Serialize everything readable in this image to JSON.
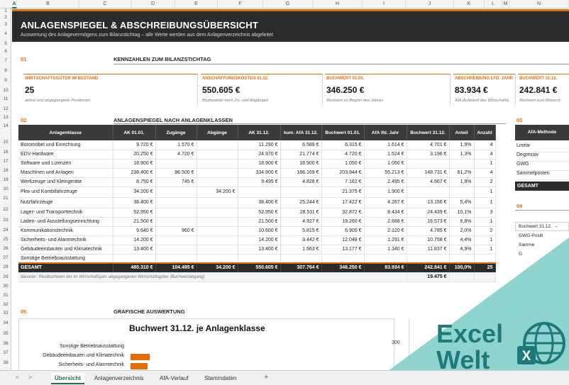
{
  "columns": [
    "A",
    "B",
    "C",
    "D",
    "E",
    "F",
    "G",
    "H",
    "I",
    "J",
    "K",
    "L",
    "M",
    "N"
  ],
  "rows": [
    "1",
    "2",
    "3",
    "4",
    "5",
    "6",
    "7",
    "8",
    "9",
    "10",
    "11",
    "12",
    "13",
    "14",
    "15",
    "16",
    "17",
    "18",
    "19",
    "20",
    "21",
    "22",
    "23",
    "24",
    "25",
    "26",
    "27",
    "28",
    "29",
    "30",
    "31",
    "32",
    "33",
    "34",
    "35",
    "36",
    "37",
    "38"
  ],
  "header": {
    "title": "ANLAGENSPIEGEL & ABSCHREIBUNGSÜBERSICHT",
    "subtitle": "Auswertung des Anlagevermögens zum Bilanzstichtag – alle Werte werden aus dem Anlagenverzeichnis abgeleitet"
  },
  "sections": {
    "s01": {
      "num": "01",
      "title": "KENNZAHLEN ZUM BILANZSTICHTAG"
    },
    "s02": {
      "num": "02",
      "title": "ANLAGENSPIEGEL NACH ANLAGENKLASSEN"
    },
    "s03": {
      "num": "03"
    },
    "s04": {
      "num": "04"
    },
    "s05": {
      "num": "05",
      "title": "GRAFISCHE AUSWERTUNG"
    }
  },
  "kpis": [
    {
      "label": "WIRTSCHAFTSGÜTER IM BESTAND",
      "value": "25",
      "sub": "aktive und abgegangene Positionen"
    },
    {
      "label": "ANSCHAFFUNGSKOSTEN 31.12.",
      "value": "550.605 €",
      "sub": "Bruttowerte nach Zu- und Abgängen"
    },
    {
      "label": "BUCHWERT 01.01.",
      "value": "346.250 €",
      "sub": "Restwert zu Beginn des Jahres"
    },
    {
      "label": "ABSCHREIBUNG LFD. JAHR",
      "value": "83.934 €",
      "sub": "AfA-Aufwand des Wirtschaftsj"
    },
    {
      "label": "BUCHWERT 31.12.",
      "value": "242.841 €",
      "sub": "Restwert zum Bilanzst"
    }
  ],
  "table": {
    "headers": [
      "Anlagenklasse",
      "AK 01.01.",
      "Zugänge",
      "Abgänge",
      "AK 31.12.",
      "kum. AfA 31.12.",
      "Buchwert 01.01.",
      "AfA lfd. Jahr",
      "Buchwert 31.12.",
      "Anteil",
      "Anzahl"
    ],
    "rows": [
      [
        "Büromöbel und Einrichtung",
        "9.720 €",
        "1.570 €",
        "",
        "11.290 €",
        "6.589 €",
        "6.315 €",
        "1.614 €",
        "4.701 €",
        "1,9%",
        "4"
      ],
      [
        "EDV-Hardware",
        "20.250 €",
        "4.720 €",
        "",
        "24.970 €",
        "21.774 €",
        "4.720 €",
        "1.524 €",
        "3.196 €",
        "1,3%",
        "4"
      ],
      [
        "Software und Lizenzen",
        "18.900 €",
        "",
        "",
        "18.900 €",
        "18.900 €",
        "1.050 €",
        "1.050 €",
        "",
        "",
        "1"
      ],
      [
        "Maschinen und Anlagen",
        "238.400 €",
        "96.500 €",
        "",
        "334.900 €",
        "186.169 €",
        "203.944 €",
        "55.213 €",
        "148.731 €",
        "61,2%",
        "4"
      ],
      [
        "Werkzeuge und Kleingeräte",
        "8.750 €",
        "745 €",
        "",
        "9.495 €",
        "4.828 €",
        "7.162 €",
        "2.495 €",
        "4.667 €",
        "1,9%",
        "2"
      ],
      [
        "Pkw und Kombifahrzeuge",
        "34.200 €",
        "",
        "34.200 €",
        "",
        "",
        "21.375 €",
        "1.900 €",
        "",
        "",
        "1"
      ],
      [
        "Nutzfahrzeuge",
        "38.400 €",
        "",
        "",
        "38.400 €",
        "25.244 €",
        "17.422 €",
        "4.267 €",
        "13.156 €",
        "5,4%",
        "1"
      ],
      [
        "Lager- und Transporttechnik",
        "52.950 €",
        "",
        "",
        "52.950 €",
        "28.511 €",
        "32.872 €",
        "8.434 €",
        "24.439 €",
        "10,1%",
        "3"
      ],
      [
        "Laden- und Ausstellungseinrichtung",
        "21.500 €",
        "",
        "",
        "21.500 €",
        "4.927 €",
        "19.260 €",
        "2.688 €",
        "16.573 €",
        "6,8%",
        "1"
      ],
      [
        "Kommunikationstechnik",
        "9.640 €",
        "960 €",
        "",
        "10.600 €",
        "5.815 €",
        "6.905 €",
        "2.120 €",
        "4.785 €",
        "2,0%",
        "2"
      ],
      [
        "Sicherheits- und Alarmtechnik",
        "14.200 €",
        "",
        "",
        "14.200 €",
        "3.442 €",
        "12.048 €",
        "1.291 €",
        "10.758 €",
        "4,4%",
        "1"
      ],
      [
        "Gebäudeeinbauten und Klimatechnik",
        "13.400 €",
        "",
        "",
        "13.400 €",
        "1.563 €",
        "13.177 €",
        "1.340 €",
        "11.837 €",
        "4,9%",
        "1"
      ],
      [
        "Sonstige Betriebsausstattung",
        "",
        "",
        "",
        "",
        "",
        "",
        "",
        "",
        "",
        ""
      ]
    ],
    "total": [
      "GESAMT",
      "480.310 €",
      "104.495 €",
      "34.200 €",
      "550.605 €",
      "307.764 €",
      "346.250 €",
      "83.934 €",
      "242.841 €",
      "100,0%",
      "25"
    ],
    "note": "darunter: Restbuchwert der im Wirtschaftsjahr abgegangenen Wirtschaftsgüter (Buchwertabgang)",
    "note_value": "19.475 €"
  },
  "afa_panel": {
    "header": "AfA-Methode",
    "items": [
      "Linear",
      "Degressiv",
      "GWG",
      "Sammelposten"
    ],
    "total": "GESAMT"
  },
  "panel04": {
    "items": [
      "Buchwert 31.12. →",
      "GWG-Positi",
      "Samme",
      "G"
    ]
  },
  "chart_data": {
    "type": "bar",
    "title": "Buchwert 31.12. je Anlagenklasse",
    "categories": [
      "Sonstige Betriebsausstattung",
      "Gebäudeeinbauten und Klimatechnik",
      "Sicherheits- und Alarmtechnik"
    ],
    "values": [
      0,
      11837,
      10758
    ],
    "orientation": "horizontal",
    "xlim": [
      0,
      160000
    ]
  },
  "chart2": {
    "axis_label": "300"
  },
  "logo": {
    "line1": "Excel",
    "line2": "Welt"
  },
  "tabs": {
    "prev": "<",
    "next": ">",
    "items": [
      "Übersicht",
      "Anlagenverzeichnis",
      "AfA-Verlauf",
      "Stammdaten"
    ],
    "active": 0,
    "add": "+"
  },
  "colors": {
    "accent": "#e36c0a",
    "dark": "#2b2b2b",
    "excel_green": "#217346",
    "teal": "#8fd3cf"
  }
}
